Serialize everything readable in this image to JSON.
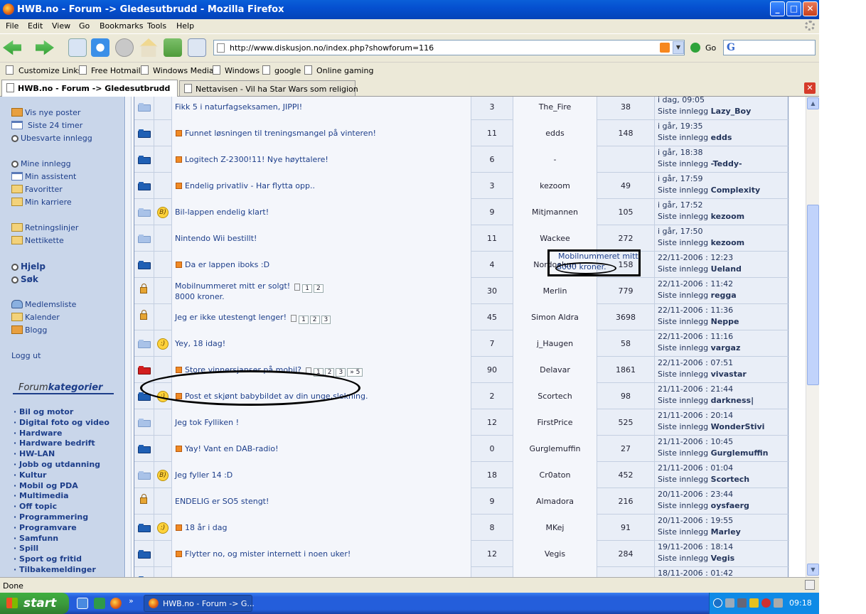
{
  "window": {
    "title": "HWB.no - Forum -> Gledesutbrudd - Mozilla Firefox",
    "buttons": {
      "minimize": "_",
      "maximize": "□",
      "close": "✕"
    }
  },
  "menu": [
    "File",
    "Edit",
    "View",
    "Go",
    "Bookmarks",
    "Tools",
    "Help"
  ],
  "address": {
    "url": "http://www.diskusjon.no/index.php?showforum=116",
    "go_label": "Go",
    "search_placeholder": "G"
  },
  "bookmarks": [
    "Customize Links",
    "Free Hotmail",
    "Windows Media",
    "Windows",
    "google",
    "Online gaming"
  ],
  "tabs": [
    {
      "label": "HWB.no - Forum -> Gledesutbrudd",
      "active": true
    },
    {
      "label": "Nettavisen - Vil ha Star Wars som religion",
      "active": false
    }
  ],
  "sidebar": {
    "group1": [
      "Vis nye poster",
      "Siste 24 timer",
      "Ubesvarte innlegg"
    ],
    "group2": [
      "Mine innlegg",
      "Min assistent",
      "Favoritter",
      "Min karriere"
    ],
    "group3": [
      "Retningslinjer",
      "Nettikette"
    ],
    "group4": [
      "Hjelp",
      "Søk"
    ],
    "group5": [
      "Medlemsliste",
      "Kalender",
      "Blogg"
    ],
    "logout": "Logg ut",
    "categories_title_a": "Forum",
    "categories_title_b": "kategorier",
    "categories": [
      "Bil og motor",
      "Digital foto og video",
      "Hardware",
      "Hardware bedrift",
      "HW-LAN",
      "Jobb og utdanning",
      "Kultur",
      "Mobil og PDA",
      "Multimedia",
      "Off topic",
      "Programmering",
      "Programvare",
      "Samfunn",
      "Spill",
      "Sport og fritid",
      "Tilbakemeldinger"
    ]
  },
  "last_post_prefix": "Siste innlegg",
  "topics": [
    {
      "folder": "light",
      "icon": "",
      "hot": false,
      "title": "Fikk 5 i naturfagseksamen, JIPPI!",
      "pages": [],
      "replies": "3",
      "author": "The_Fire",
      "views": "38",
      "date": "i dag, 09:05",
      "last_by": "Lazy_Boy"
    },
    {
      "folder": "dark",
      "icon": "",
      "hot": true,
      "title": "Funnet løsningen til treningsmangel på vinteren!",
      "pages": [],
      "replies": "11",
      "author": "edds",
      "views": "148",
      "date": "i går, 19:35",
      "last_by": "edds"
    },
    {
      "folder": "dark",
      "icon": "",
      "hot": true,
      "title": "Logitech Z-2300!11! Nye høyttalere!",
      "pages": [],
      "replies": "6",
      "author": "-",
      "views": "",
      "date": "i går, 18:38",
      "last_by": "-Teddy-"
    },
    {
      "folder": "dark",
      "icon": "",
      "hot": true,
      "title": "Endelig privatliv - Har flytta opp..",
      "pages": [],
      "replies": "3",
      "author": "kezoom",
      "views": "49",
      "date": "i går, 17:59",
      "last_by": "Complexity"
    },
    {
      "folder": "light",
      "icon": "cool",
      "hot": false,
      "title": "Bil-lappen endelig klart!",
      "pages": [],
      "replies": "9",
      "author": "Mitjmannen",
      "views": "105",
      "date": "i går, 17:52",
      "last_by": "kezoom"
    },
    {
      "folder": "light",
      "icon": "",
      "hot": false,
      "title": "Nintendo Wii bestillt!",
      "pages": [],
      "replies": "11",
      "author": "Wackee",
      "views": "272",
      "date": "i går, 17:50",
      "last_by": "kezoom"
    },
    {
      "folder": "dark",
      "icon": "",
      "hot": true,
      "title": "Da er lappen iboks :D",
      "pages": [],
      "replies": "4",
      "author": "Nordoelum",
      "views": "158",
      "date": "22/11-2006 : 12:23",
      "last_by": "Ueland"
    },
    {
      "folder": "lock",
      "icon": "",
      "hot": false,
      "title": "Mobilnummeret mitt er solgt!",
      "subtitle": "8000 kroner.",
      "pages": [
        "1",
        "2"
      ],
      "replies": "30",
      "author": "Merlin",
      "views": "779",
      "date": "22/11-2006 : 11:42",
      "last_by": "regga"
    },
    {
      "folder": "lock",
      "icon": "",
      "hot": false,
      "title": "Jeg er ikke utestengt lenger!",
      "pages": [
        "1",
        "2",
        "3"
      ],
      "replies": "45",
      "author": "Simon Aldra",
      "views": "3698",
      "date": "22/11-2006 : 11:36",
      "last_by": "Neppe"
    },
    {
      "folder": "light",
      "icon": "smile",
      "hot": false,
      "title": "Yey, 18 idag!",
      "pages": [],
      "replies": "7",
      "author": "j_Haugen",
      "views": "58",
      "date": "22/11-2006 : 11:16",
      "last_by": "vargaz"
    },
    {
      "folder": "red",
      "icon": "",
      "hot": true,
      "title": "Store vinnersjanser på mobil?",
      "pages": [
        "1",
        "2",
        "3",
        "» 5"
      ],
      "replies": "90",
      "author": "Delavar",
      "views": "1861",
      "date": "22/11-2006 : 07:51",
      "last_by": "vivastar"
    },
    {
      "folder": "dark",
      "icon": "smile",
      "hot": true,
      "title": "Post et skjønt babybildet av din unge,slekning.",
      "pages": [],
      "replies": "2",
      "author": "Scortech",
      "views": "98",
      "date": "21/11-2006 : 21:44",
      "last_by": "darkness|"
    },
    {
      "folder": "light",
      "icon": "",
      "hot": false,
      "title": "Jeg tok Fylliken !",
      "pages": [],
      "replies": "12",
      "author": "FirstPrice",
      "views": "525",
      "date": "21/11-2006 : 20:14",
      "last_by": "WonderStivi"
    },
    {
      "folder": "dark",
      "icon": "",
      "hot": true,
      "title": "Yay! Vant en DAB-radio!",
      "pages": [],
      "replies": "0",
      "author": "Gurglemuffin",
      "views": "27",
      "date": "21/11-2006 : 10:45",
      "last_by": "Gurglemuffin"
    },
    {
      "folder": "light",
      "icon": "cool",
      "hot": false,
      "title": "Jeg fyller 14 :D",
      "pages": [],
      "replies": "18",
      "author": "Cr0aton",
      "views": "452",
      "date": "21/11-2006 : 01:04",
      "last_by": "Scortech"
    },
    {
      "folder": "lock",
      "icon": "",
      "hot": false,
      "title": "ENDELIG er SO5 stengt!",
      "pages": [],
      "replies": "9",
      "author": "Almadora",
      "views": "216",
      "date": "20/11-2006 : 23:44",
      "last_by": "oysfaerg"
    },
    {
      "folder": "dark",
      "icon": "smile",
      "hot": true,
      "title": "18 år i dag",
      "pages": [],
      "replies": "8",
      "author": "MKej",
      "views": "91",
      "date": "20/11-2006 : 19:55",
      "last_by": "Marley"
    },
    {
      "folder": "dark",
      "icon": "",
      "hot": true,
      "title": "Flytter no, og mister internett i noen uker!",
      "pages": [],
      "replies": "12",
      "author": "Vegis",
      "views": "284",
      "date": "19/11-2006 : 18:14",
      "last_by": "Vegis"
    },
    {
      "folder": "dark",
      "icon": "",
      "hot": false,
      "title": "",
      "pages": [],
      "replies": "",
      "author": "",
      "views": "",
      "date": "18/11-2006 : 01:42",
      "last_by": ""
    }
  ],
  "annotation": {
    "line1": "Mobilnummeret mitt",
    "line2": "8000 kroner."
  },
  "status": "Done",
  "taskbar": {
    "start": "start",
    "item": "HWB.no - Forum -> G...",
    "clock": "09:18"
  }
}
